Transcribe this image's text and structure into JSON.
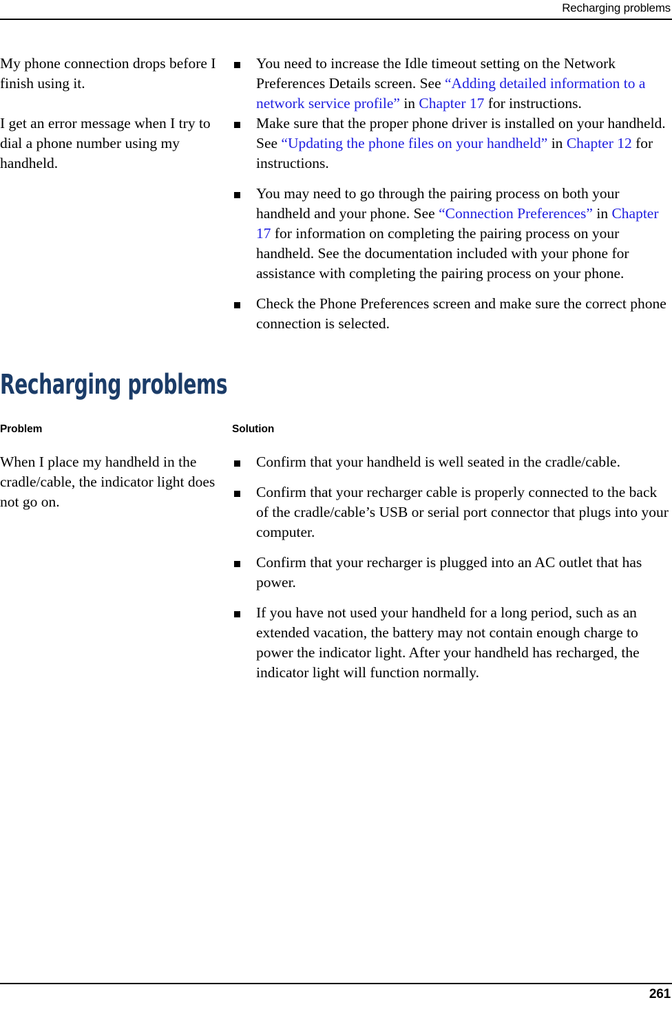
{
  "header": {
    "running_head": "Recharging problems"
  },
  "footer": {
    "page_number": "261"
  },
  "colors": {
    "heading": "#1b3c68",
    "link": "#2020e0",
    "body_text": "#000000",
    "rule": "#000000"
  },
  "continued_table": {
    "rows": [
      {
        "problem": "My phone connection drops before I finish using it.",
        "solutions": [
          {
            "parts": [
              {
                "t": "You need to increase the Idle timeout setting on the Network Preferences Details screen. See ",
                "link": false
              },
              {
                "t": "“Adding detailed information to a network service profile”",
                "link": true
              },
              {
                "t": " in ",
                "link": false
              },
              {
                "t": "Chapter 17",
                "link": true
              },
              {
                "t": " for instructions.",
                "link": false
              }
            ]
          }
        ]
      },
      {
        "problem": "I get an error message when I try to dial a phone number using my handheld.",
        "solutions": [
          {
            "parts": [
              {
                "t": "Make sure that the proper phone driver is installed on your handheld. See ",
                "link": false
              },
              {
                "t": "“Updating the phone files on your handheld”",
                "link": true
              },
              {
                "t": " in ",
                "link": false
              },
              {
                "t": "Chapter 12",
                "link": true
              },
              {
                "t": " for instructions.",
                "link": false
              }
            ]
          },
          {
            "parts": [
              {
                "t": "You may need to go through the pairing process on both your handheld and your phone. See ",
                "link": false
              },
              {
                "t": "“Connection Preferences”",
                "link": true
              },
              {
                "t": " in ",
                "link": false
              },
              {
                "t": "Chapter 17",
                "link": true
              },
              {
                "t": " for information on completing the pairing process on your handheld. See the documentation included with your phone for assistance with completing the pairing process on your phone.",
                "link": false
              }
            ]
          },
          {
            "parts": [
              {
                "t": "Check the Phone Preferences screen and make sure the correct phone connection is selected.",
                "link": false
              }
            ]
          }
        ]
      }
    ]
  },
  "section": {
    "heading": "Recharging problems",
    "column_headers": {
      "problem": "Problem",
      "solution": "Solution"
    },
    "rows": [
      {
        "problem": "When I place my handheld in the cradle/cable, the indicator light does not go on.",
        "solutions": [
          {
            "parts": [
              {
                "t": "Confirm that your handheld is well seated in the cradle/cable.",
                "link": false
              }
            ]
          },
          {
            "parts": [
              {
                "t": "Confirm that your recharger cable is properly connected to the back of the cradle/cable’s USB or serial port connector that plugs into your computer.",
                "link": false
              }
            ]
          },
          {
            "parts": [
              {
                "t": "Confirm that your recharger is plugged into an AC outlet that has power.",
                "link": false
              }
            ]
          },
          {
            "parts": [
              {
                "t": "If you have not used your handheld for a long period, such as an extended vacation, the battery may not contain enough charge to power the indicator light. After your handheld has recharged, the indicator light will function normally.",
                "link": false
              }
            ]
          }
        ]
      }
    ]
  }
}
